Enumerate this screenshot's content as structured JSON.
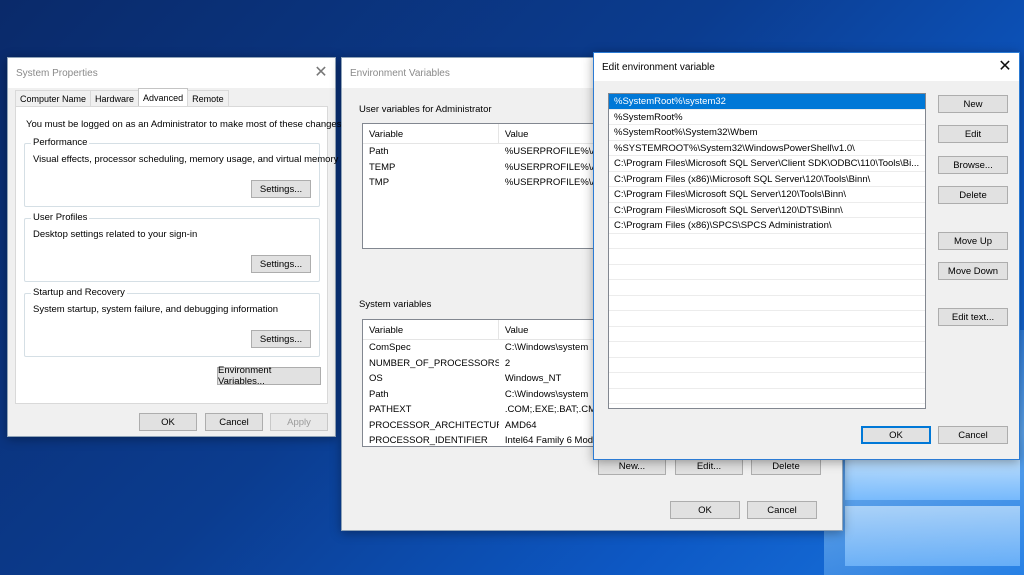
{
  "system_properties": {
    "title": "System Properties",
    "tabs": [
      {
        "label": "Computer Name"
      },
      {
        "label": "Hardware"
      },
      {
        "label": "Advanced"
      },
      {
        "label": "Remote"
      }
    ],
    "admin_notice": "You must be logged on as an Administrator to make most of these changes.",
    "performance": {
      "title": "Performance",
      "description": "Visual effects, processor scheduling, memory usage, and virtual memory",
      "button": "Settings..."
    },
    "user_profiles": {
      "title": "User Profiles",
      "description": "Desktop settings related to your sign-in",
      "button": "Settings..."
    },
    "startup_recovery": {
      "title": "Startup and Recovery",
      "description": "System startup, system failure, and debugging information",
      "button": "Settings..."
    },
    "env_button": "Environment Variables...",
    "ok": "OK",
    "cancel": "Cancel",
    "apply": "Apply"
  },
  "environment_variables": {
    "title": "Environment Variables",
    "user_section": "User variables for Administrator",
    "user_columns": [
      "Variable",
      "Value"
    ],
    "user_rows": [
      {
        "variable": "Path",
        "value": "%USERPROFILE%\\Ap"
      },
      {
        "variable": "TEMP",
        "value": "%USERPROFILE%\\Ap"
      },
      {
        "variable": "TMP",
        "value": "%USERPROFILE%\\Ap"
      }
    ],
    "system_section": "System variables",
    "system_columns": [
      "Variable",
      "Value"
    ],
    "system_rows": [
      {
        "variable": "ComSpec",
        "value": "C:\\Windows\\system"
      },
      {
        "variable": "NUMBER_OF_PROCESSORS",
        "value": "2"
      },
      {
        "variable": "OS",
        "value": "Windows_NT"
      },
      {
        "variable": "Path",
        "value": "C:\\Windows\\system"
      },
      {
        "variable": "PATHEXT",
        "value": ".COM;.EXE;.BAT;.CM"
      },
      {
        "variable": "PROCESSOR_ARCHITECTURE",
        "value": "AMD64"
      },
      {
        "variable": "PROCESSOR_IDENTIFIER",
        "value": "Intel64 Family 6 Mod"
      }
    ],
    "new": "New...",
    "edit": "Edit...",
    "delete": "Delete",
    "ok": "OK",
    "cancel": "Cancel"
  },
  "edit_variable": {
    "title": "Edit environment variable",
    "entries": [
      "%SystemRoot%\\system32",
      "%SystemRoot%",
      "%SystemRoot%\\System32\\Wbem",
      "%SYSTEMROOT%\\System32\\WindowsPowerShell\\v1.0\\",
      "C:\\Program Files\\Microsoft SQL Server\\Client SDK\\ODBC\\110\\Tools\\Bi...",
      "C:\\Program Files (x86)\\Microsoft SQL Server\\120\\Tools\\Binn\\",
      "C:\\Program Files\\Microsoft SQL Server\\120\\Tools\\Binn\\",
      "C:\\Program Files\\Microsoft SQL Server\\120\\DTS\\Binn\\",
      "C:\\Program Files (x86)\\SPCS\\SPCS Administration\\"
    ],
    "selected_index": 0,
    "buttons": {
      "new": "New",
      "edit": "Edit",
      "browse": "Browse...",
      "delete": "Delete",
      "move_up": "Move Up",
      "move_down": "Move Down",
      "edit_text": "Edit text...",
      "ok": "OK",
      "cancel": "Cancel"
    }
  }
}
